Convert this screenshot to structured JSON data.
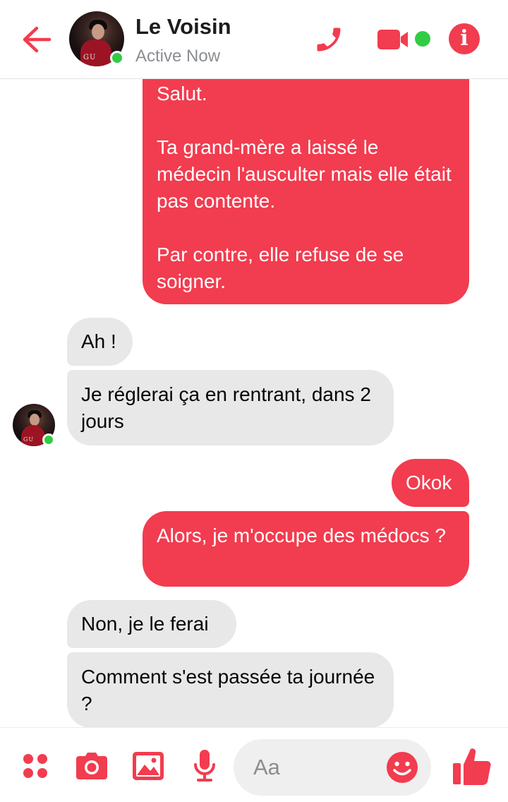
{
  "colors": {
    "accent": "#f23c4f",
    "online": "#31cc46",
    "incoming_bubble": "#e8e8e8",
    "status_text": "#8a8d91"
  },
  "header": {
    "contact_name": "Le Voisin",
    "status": "Active Now",
    "avatar_tag": "GU",
    "icons": [
      "back-arrow-icon",
      "phone-icon",
      "video-camera-icon",
      "info-icon"
    ]
  },
  "messages": [
    {
      "direction": "outgoing",
      "text": "Salut.\n\nTa grand-mère a laissé le médecin l'ausculter mais elle était pas contente.\n\nPar contre, elle refuse de se soigner."
    },
    {
      "direction": "incoming",
      "text": "Ah !"
    },
    {
      "direction": "incoming",
      "text": "Je réglerai ça en rentrant, dans 2 jours"
    },
    {
      "direction": "outgoing",
      "text": "Okok"
    },
    {
      "direction": "outgoing",
      "text": "Alors, je m'occupe des médocs ?"
    },
    {
      "direction": "incoming",
      "text": "Non, je le ferai"
    },
    {
      "direction": "incoming",
      "text": "Comment s'est passée ta journée ?"
    }
  ],
  "composer": {
    "placeholder": "Aa",
    "value": "",
    "tools": [
      "more-apps-icon",
      "camera-icon",
      "gallery-icon",
      "microphone-icon"
    ],
    "emoji_icon": "smiley-icon",
    "send_icon": "thumbs-up-icon"
  }
}
